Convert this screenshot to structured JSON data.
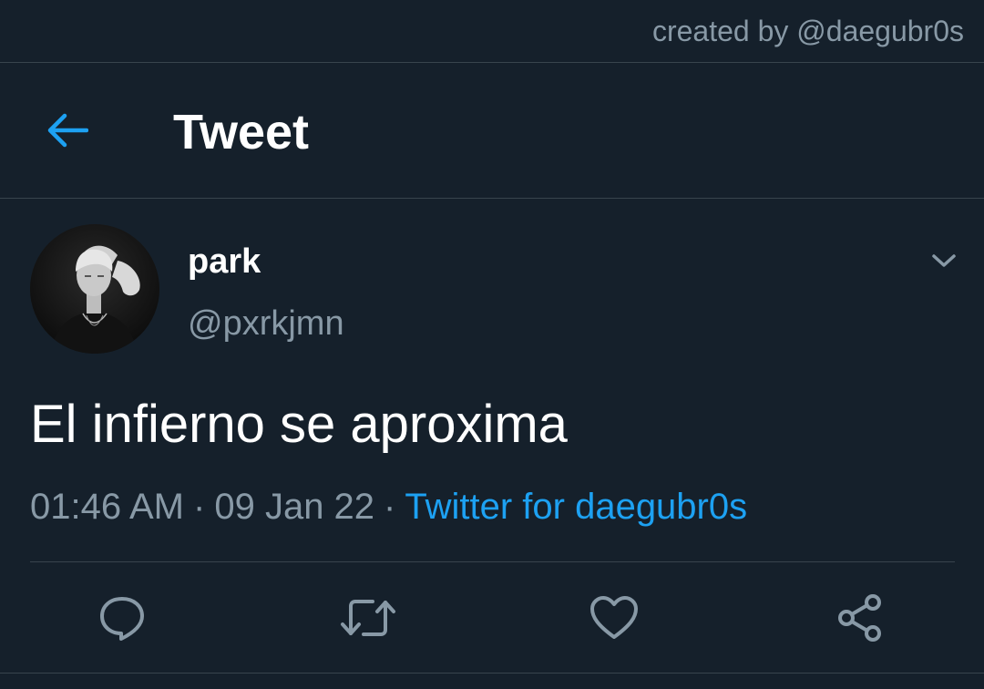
{
  "credit": {
    "text": "created by @daegubr0s"
  },
  "header": {
    "title": "Tweet",
    "back_icon": "arrow-left-icon"
  },
  "tweet": {
    "display_name": "park",
    "handle": "@pxrkjmn",
    "text": "El infierno se aproxima",
    "time": "01:46 AM",
    "date": "09 Jan 22",
    "separator": "·",
    "source": "Twitter for daegubr0s"
  },
  "actions": [
    {
      "name": "reply",
      "icon": "comment-icon"
    },
    {
      "name": "retweet",
      "icon": "retweet-icon"
    },
    {
      "name": "like",
      "icon": "heart-icon"
    },
    {
      "name": "share",
      "icon": "share-icon"
    }
  ],
  "colors": {
    "background": "#15202b",
    "accent": "#1da1f2",
    "secondary_text": "#8899a6",
    "border": "#38444d",
    "primary_text": "#ffffff"
  }
}
